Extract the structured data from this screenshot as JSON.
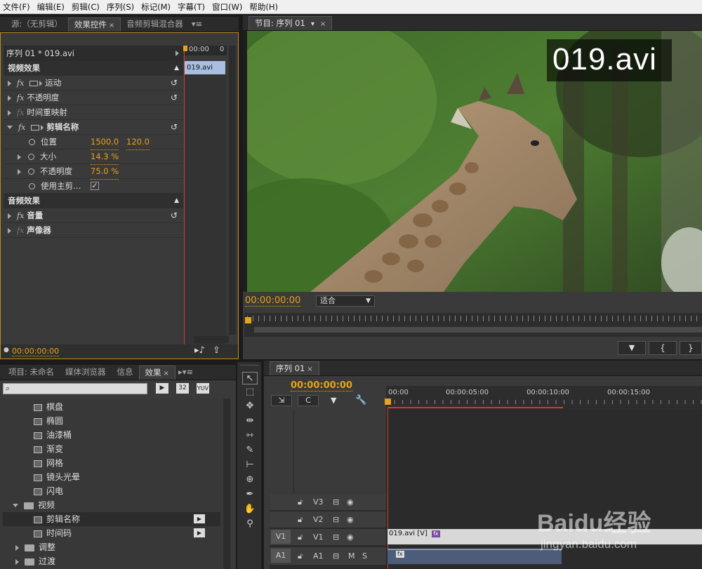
{
  "menu": [
    "文件(F)",
    "编辑(E)",
    "剪辑(C)",
    "序列(S)",
    "标记(M)",
    "字幕(T)",
    "窗口(W)",
    "帮助(H)"
  ],
  "top_left_tabs": {
    "source": "源:（无剪辑）",
    "effect_controls": "效果控件",
    "audio_mixer": "音频剪辑混合器"
  },
  "effect_controls": {
    "clip_path": "序列 01 * 019.avi",
    "mini_ruler_start": "00:00",
    "mini_ruler_end": "0",
    "clip_bar_label": "019.avi",
    "video_effects": "视频效果",
    "motion": "运动",
    "opacity": "不透明度",
    "time_remap": "时间重映射",
    "clip_name_effect": "剪辑名称",
    "position_label": "位置",
    "position_x": "1500.0",
    "position_y": "120.0",
    "size_label": "大小",
    "size_value": "14.3 %",
    "opacity_label": "不透明度",
    "opacity_value": "75.0 %",
    "use_master_label": "使用主剪…",
    "audio_effects": "音频效果",
    "volume": "音量",
    "panner": "声像器",
    "timecode": "00:00:00:00",
    "fx_glyph": "fx"
  },
  "program_monitor": {
    "tab": "节目: 序列 01",
    "overlay_text": "019.avi",
    "timecode": "00:00:00:00",
    "fit_option": "适合"
  },
  "bottom_left_tabs": {
    "project": "项目: 未命名",
    "media_browser": "媒体浏览器",
    "info": "信息",
    "effects": "效果"
  },
  "effects_panel": {
    "search_placeholder": "",
    "icon_labels": [
      "32",
      "YUV"
    ],
    "items": [
      "棋盘",
      "椭圆",
      "油漆桶",
      "渐变",
      "网格",
      "镜头光晕",
      "闪电"
    ],
    "video_folder": "视频",
    "video_items": [
      "剪辑名称",
      "时间码"
    ],
    "more_folders": [
      "调整",
      "过渡"
    ]
  },
  "timeline": {
    "tab": "序列 01",
    "timecode": "00:00:00:00",
    "ruler": [
      "00:00",
      "00:00:05:00",
      "00:00:10:00",
      "00:00:15:00"
    ],
    "tracks": [
      {
        "src": "",
        "name": "V3"
      },
      {
        "src": "",
        "name": "V2"
      },
      {
        "src": "V1",
        "name": "V1"
      },
      {
        "src": "A1",
        "name": "A1"
      }
    ],
    "audio_buttons": [
      "M",
      "S"
    ],
    "video_clip_label": "019.avi [V]",
    "fx_badge": "fx"
  },
  "watermark": {
    "brand": "Baidu经验",
    "url": "jingyan.baidu.com"
  },
  "colors": {
    "accent": "#e8a21c",
    "playhead": "#d43a2a",
    "clip_video": "#d8d8d8",
    "clip_audio": "#4d5c78",
    "fx_badge": "#7a4a9c"
  }
}
